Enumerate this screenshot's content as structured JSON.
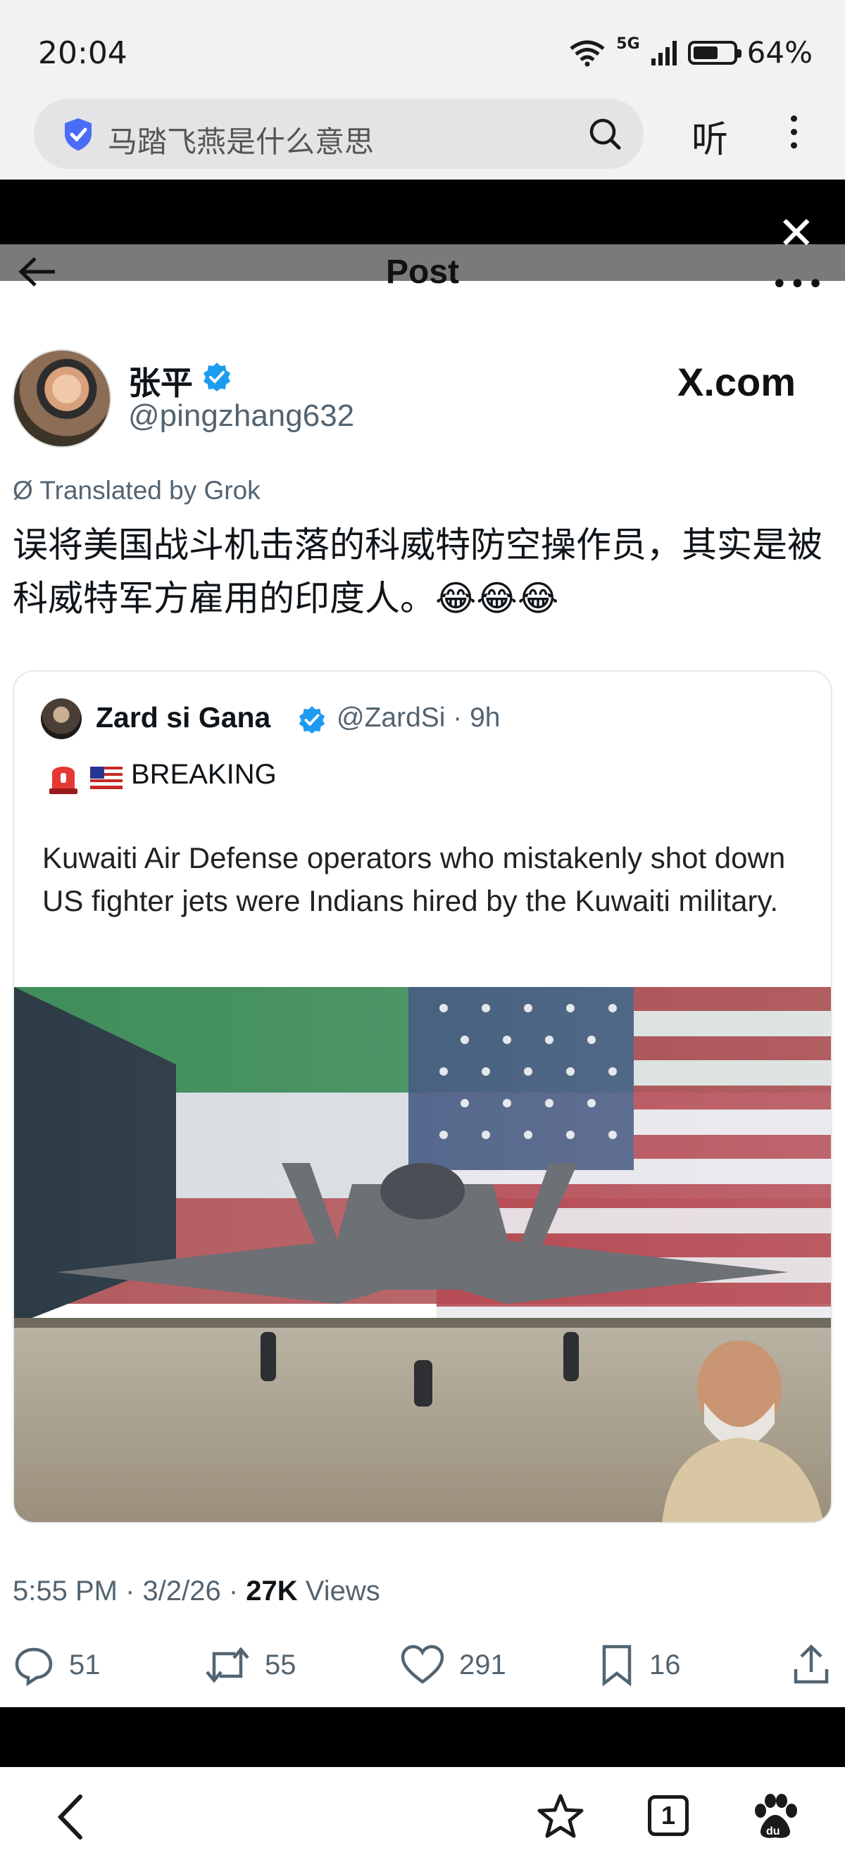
{
  "status_bar": {
    "time": "20:04",
    "network": "5G",
    "battery": "64%",
    "battery_level": 0.64
  },
  "browser": {
    "search_query": "马踏飞燕是什么意思",
    "listen_label": "听",
    "close_symbol": "✕"
  },
  "post_header": {
    "title": "Post"
  },
  "author": {
    "name": "张平",
    "handle": "@pingzhang632",
    "site_logo": "X.com"
  },
  "tweet": {
    "translated_label": "Translated by Grok",
    "text": "误将美国战斗机击落的科威特防空操作员，其实是被科威特军方雇用的印度人。😂😂😂"
  },
  "quote": {
    "name": "Zard si Gana",
    "handle_time": "@ZardSi · 9h",
    "breaking": "BREAKING",
    "text": "Kuwaiti Air Defense operators who mistakenly shot down US fighter jets were Indians hired by the Kuwaiti military."
  },
  "meta": {
    "time_date": "5:55 PM · 3/2/26 · ",
    "views_count": "27K",
    "views_label": " Views"
  },
  "actions": {
    "replies": "51",
    "reposts": "55",
    "likes": "291",
    "bookmarks": "16"
  },
  "bottom_nav": {
    "tab_count": "1"
  },
  "colors": {
    "verified": "#1d9bf0",
    "text_secondary": "#536471"
  }
}
